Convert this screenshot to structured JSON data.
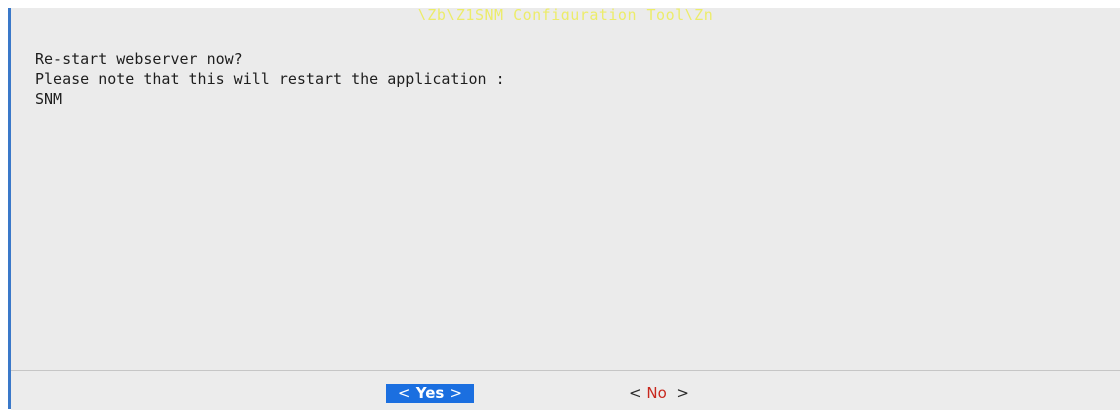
{
  "dialog": {
    "title": "\\Zb\\Z1SNM Configuration Tool\\Zn",
    "message_lines": [
      "Re-start webserver now?",
      "Please note that this will restart the application :",
      "SNM"
    ]
  },
  "buttons": {
    "yes": {
      "left": "<",
      "label": "Yes",
      "right": ">"
    },
    "no": {
      "left": "<",
      "label": "No",
      "right": ">"
    }
  },
  "colors": {
    "title": "#ecec6a",
    "selected_button_bg": "#1b6fe0",
    "hotkey": "#c8281e",
    "border_accent": "#3a78c9"
  }
}
